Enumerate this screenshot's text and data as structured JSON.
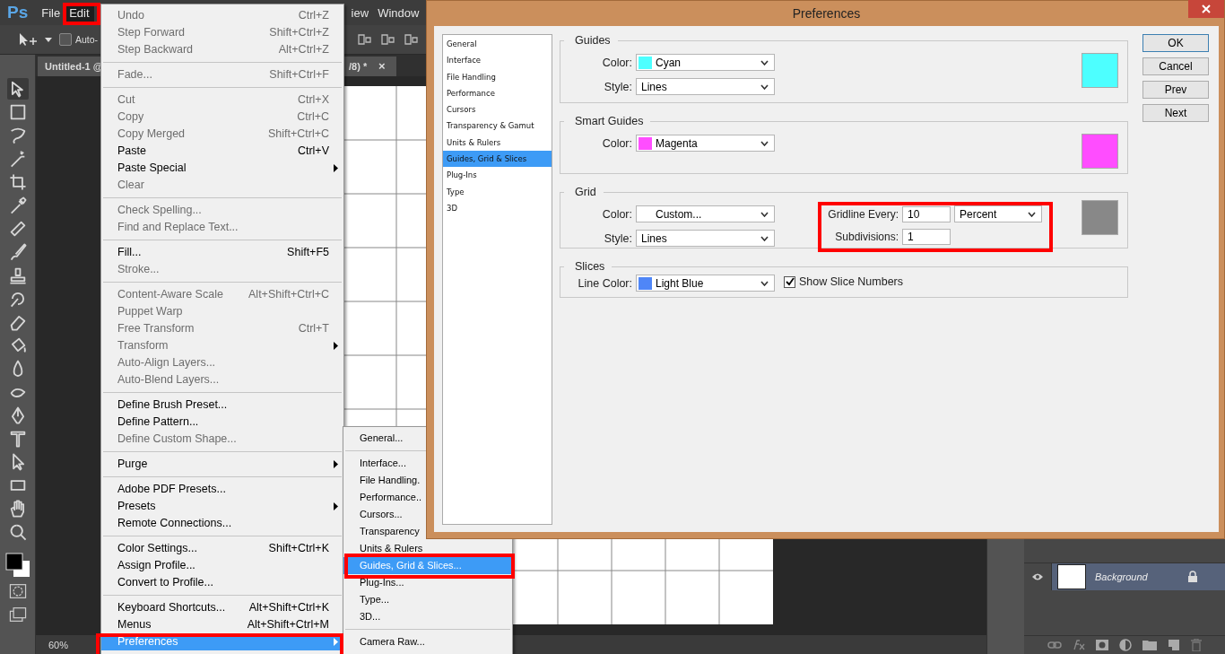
{
  "menubar": {
    "logo": "Ps",
    "items": [
      {
        "label": "File",
        "selected": false
      },
      {
        "label": "Edit",
        "selected": true
      },
      {
        "label": "iew",
        "selected": false
      },
      {
        "label": "Window",
        "selected": false
      }
    ]
  },
  "options_bar": {
    "checkbox": {
      "label": "Auto-",
      "checked": false
    }
  },
  "document_tab": {
    "title": "Untitled-1 @",
    "title_end": "/8) *",
    "close": "×"
  },
  "status_bar": {
    "zoom": "60%"
  },
  "edit_menu": {
    "groups": [
      [
        {
          "label": "Undo",
          "shortcut": "Ctrl+Z",
          "disabled": true,
          "selected": false
        },
        {
          "label": "Step Forward",
          "shortcut": "Shift+Ctrl+Z",
          "disabled": true,
          "selected": false
        },
        {
          "label": "Step Backward",
          "shortcut": "Alt+Ctrl+Z",
          "disabled": true,
          "selected": false
        }
      ],
      [
        {
          "label": "Fade...",
          "shortcut": "Shift+Ctrl+F",
          "disabled": true,
          "selected": false
        }
      ],
      [
        {
          "label": "Cut",
          "shortcut": "Ctrl+X",
          "disabled": true,
          "selected": false
        },
        {
          "label": "Copy",
          "shortcut": "Ctrl+C",
          "disabled": true,
          "selected": false
        },
        {
          "label": "Copy Merged",
          "shortcut": "Shift+Ctrl+C",
          "disabled": true,
          "selected": false
        },
        {
          "label": "Paste",
          "shortcut": "Ctrl+V",
          "disabled": false,
          "selected": false
        },
        {
          "label": "Paste Special",
          "submenu": true,
          "disabled": false,
          "selected": false
        },
        {
          "label": "Clear",
          "disabled": true,
          "selected": false
        }
      ],
      [
        {
          "label": "Check Spelling...",
          "disabled": true,
          "selected": false
        },
        {
          "label": "Find and Replace Text...",
          "disabled": true,
          "selected": false
        }
      ],
      [
        {
          "label": "Fill...",
          "shortcut": "Shift+F5",
          "disabled": false,
          "selected": false
        },
        {
          "label": "Stroke...",
          "disabled": true,
          "selected": false
        }
      ],
      [
        {
          "label": "Content-Aware Scale",
          "shortcut": "Alt+Shift+Ctrl+C",
          "disabled": true,
          "selected": false
        },
        {
          "label": "Puppet Warp",
          "disabled": true,
          "selected": false
        },
        {
          "label": "Free Transform",
          "shortcut": "Ctrl+T",
          "disabled": true,
          "selected": false
        },
        {
          "label": "Transform",
          "submenu": true,
          "disabled": true,
          "selected": false
        },
        {
          "label": "Auto-Align Layers...",
          "disabled": true,
          "selected": false
        },
        {
          "label": "Auto-Blend Layers...",
          "disabled": true,
          "selected": false
        }
      ],
      [
        {
          "label": "Define Brush Preset...",
          "disabled": false,
          "selected": false
        },
        {
          "label": "Define Pattern...",
          "disabled": false,
          "selected": false
        },
        {
          "label": "Define Custom Shape...",
          "disabled": true,
          "selected": false
        }
      ],
      [
        {
          "label": "Purge",
          "submenu": true,
          "disabled": false,
          "selected": false
        }
      ],
      [
        {
          "label": "Adobe PDF Presets...",
          "disabled": false,
          "selected": false
        },
        {
          "label": "Presets",
          "submenu": true,
          "disabled": false,
          "selected": false
        },
        {
          "label": "Remote Connections...",
          "disabled": false,
          "selected": false
        }
      ],
      [
        {
          "label": "Color Settings...",
          "shortcut": "Shift+Ctrl+K",
          "disabled": false,
          "selected": false
        },
        {
          "label": "Assign Profile...",
          "disabled": false,
          "selected": false
        },
        {
          "label": "Convert to Profile...",
          "disabled": false,
          "selected": false
        }
      ],
      [
        {
          "label": "Keyboard Shortcuts...",
          "shortcut": "Alt+Shift+Ctrl+K",
          "disabled": false,
          "selected": false
        },
        {
          "label": "Menus",
          "shortcut": "Alt+Shift+Ctrl+M",
          "disabled": false,
          "selected": false
        },
        {
          "label": "Preferences",
          "submenu": true,
          "disabled": false,
          "selected": true
        }
      ]
    ]
  },
  "preferences_menu": {
    "groups": [
      [
        {
          "label": "General...",
          "selected": false
        }
      ],
      [
        {
          "label": "Interface...",
          "selected": false
        },
        {
          "label": "File Handling.",
          "selected": false
        },
        {
          "label": "Performance..",
          "selected": false
        },
        {
          "label": "Cursors...",
          "selected": false
        },
        {
          "label": "Transparency",
          "selected": false
        },
        {
          "label": "Units & Rulers",
          "selected": false
        },
        {
          "label": "Guides, Grid & Slices...",
          "selected": true
        },
        {
          "label": "Plug-Ins...",
          "selected": false
        },
        {
          "label": "Type...",
          "selected": false
        },
        {
          "label": "3D...",
          "selected": false
        }
      ],
      [
        {
          "label": "Camera Raw...",
          "selected": false
        }
      ]
    ]
  },
  "dialog": {
    "title": "Preferences",
    "categories": [
      {
        "label": "General",
        "selected": false
      },
      {
        "label": "Interface",
        "selected": false
      },
      {
        "label": "File Handling",
        "selected": false
      },
      {
        "label": "Performance",
        "selected": false
      },
      {
        "label": "Cursors",
        "selected": false
      },
      {
        "label": "Transparency & Gamut",
        "selected": false
      },
      {
        "label": "Units & Rulers",
        "selected": false
      },
      {
        "label": "Guides, Grid & Slices",
        "selected": true
      },
      {
        "label": "Plug-Ins",
        "selected": false
      },
      {
        "label": "Type",
        "selected": false
      },
      {
        "label": "3D",
        "selected": false
      }
    ],
    "sections": [
      {
        "title": "Guides",
        "color": "#4dffff",
        "fields": [
          {
            "kind": "color",
            "label": "Color:",
            "value": "Cyan",
            "color": "#4dffff"
          },
          {
            "kind": "select",
            "label": "Style:",
            "value": "Lines"
          }
        ]
      },
      {
        "title": "Smart Guides",
        "color": "#ff4dff",
        "fields": [
          {
            "kind": "color",
            "label": "Color:",
            "value": "Magenta",
            "color": "#ff4dff"
          }
        ]
      },
      {
        "title": "Grid",
        "color": "#888888",
        "fields": [
          {
            "kind": "color",
            "label": "Color:",
            "value": "Custom..."
          },
          {
            "kind": "select",
            "label": "Style:",
            "value": "Lines"
          }
        ],
        "gridline": {
          "label": "Gridline Every:",
          "value": "10",
          "unit": "Percent",
          "subdivisions_label": "Subdivisions:",
          "subdivisions": "1"
        }
      },
      {
        "title": "Slices",
        "fields": [
          {
            "kind": "color",
            "label": "Line Color:",
            "value": "Light Blue",
            "color": "#4f86f7"
          }
        ],
        "checkbox": {
          "label": "Show Slice Numbers",
          "checked": true
        }
      }
    ],
    "buttons": [
      {
        "label": "OK",
        "default": true
      },
      {
        "label": "Cancel",
        "default": false
      },
      {
        "label": "Prev",
        "default": false
      },
      {
        "label": "Next",
        "default": false
      }
    ]
  },
  "layers": [
    {
      "name": "Background",
      "visible": true,
      "locked": true,
      "selected": true
    }
  ]
}
